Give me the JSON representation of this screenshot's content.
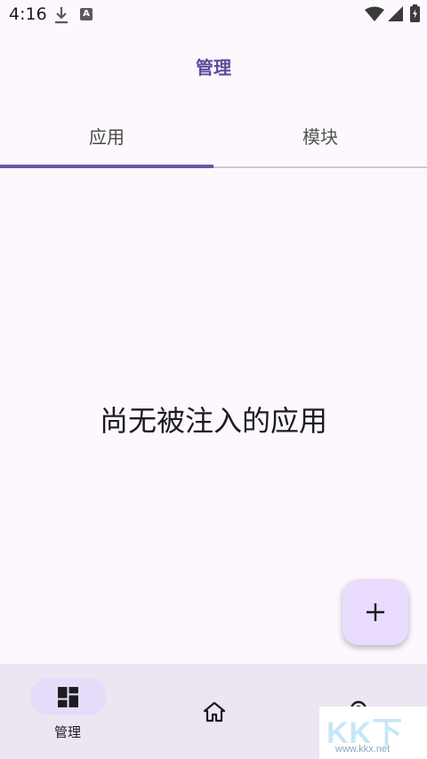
{
  "status_bar": {
    "time": "4:16"
  },
  "header": {
    "title": "管理"
  },
  "tabs": [
    {
      "label": "应用",
      "selected": true
    },
    {
      "label": "模块",
      "selected": false
    }
  ],
  "empty_state": {
    "message": "尚无被注入的应用"
  },
  "fab": {
    "icon": "plus-icon"
  },
  "bottom_nav": {
    "items": [
      {
        "label": "管理",
        "icon": "dashboard-icon",
        "selected": true
      },
      {
        "label": "",
        "icon": "home-icon",
        "selected": false
      },
      {
        "label": "",
        "icon": "settings-icon",
        "selected": false
      }
    ]
  },
  "watermark": {
    "big": "KK下载",
    "small": "www.kkx.net"
  },
  "colors": {
    "accent": "#6a55a8",
    "title": "#5d4a9a",
    "fab_bg": "#e9dcff",
    "nav_bg": "#ece6f2",
    "pill": "#e6dcfa"
  }
}
